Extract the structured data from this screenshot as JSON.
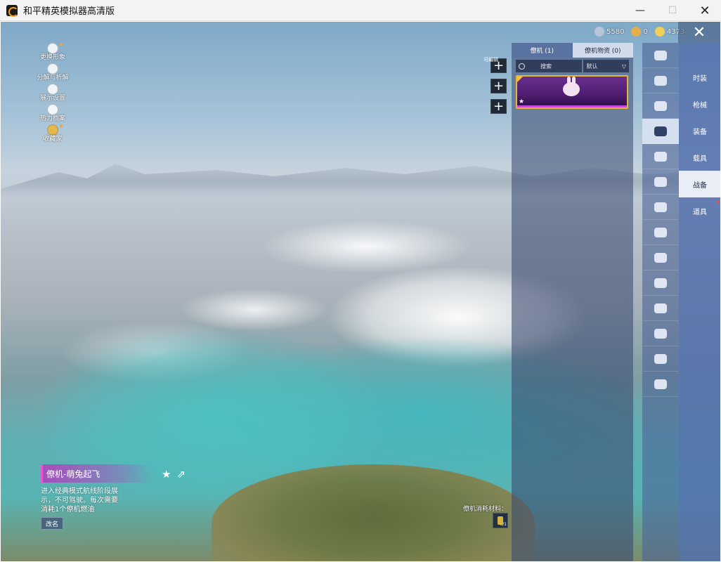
{
  "window": {
    "title": "和平精英模拟器高清版",
    "minimize": "—",
    "maximize": "☐",
    "close": "✕"
  },
  "quick_menu": [
    {
      "label": "更换形象",
      "icon": "avatar-icon",
      "dot": true
    },
    {
      "label": "分解与析解",
      "icon": "disassemble-icon",
      "dot": false
    },
    {
      "label": "展示设置",
      "icon": "eye-icon",
      "dot": false
    },
    {
      "label": "热力档案",
      "icon": "fire-icon",
      "dot": false
    },
    {
      "label": "收藏家",
      "icon": "collector-badge-icon",
      "dot": true
    }
  ],
  "currencies": [
    {
      "value": "5580",
      "icon": "coin-icon",
      "color": "#b8c4d8"
    },
    {
      "value": "0",
      "icon": "token-icon",
      "color": "#e2b04c"
    },
    {
      "value": "4373",
      "icon": "shield-coin-icon",
      "color": "#f0cf57"
    }
  ],
  "close_panel": "✕",
  "plus_buttons": {
    "label": "可编辑",
    "items": [
      "+",
      "+",
      "+"
    ]
  },
  "panel": {
    "tabs": [
      {
        "label": "僚机 (1)",
        "active": true
      },
      {
        "label": "僚机物资 (0)",
        "active": false
      }
    ],
    "search_label": "搜索",
    "sort_label": "默认",
    "sort_arrow": "▽",
    "item": {
      "star": "★",
      "rarity_color": "#e7b33a"
    }
  },
  "icon_column": [
    {
      "icon": "hat-icon",
      "selected": false
    },
    {
      "icon": "boat-icon",
      "selected": false
    },
    {
      "icon": "gun-icon",
      "selected": false
    },
    {
      "icon": "glider-icon",
      "selected": true
    },
    {
      "icon": "smile-icon",
      "selected": false
    },
    {
      "icon": "plane-icon",
      "selected": false
    },
    {
      "icon": "robot-icon",
      "selected": false
    },
    {
      "icon": "speaker-icon",
      "selected": false
    },
    {
      "icon": "camera-icon",
      "selected": false
    },
    {
      "icon": "gallery-icon",
      "selected": false
    },
    {
      "icon": "spray-icon",
      "selected": false
    },
    {
      "icon": "tap-icon",
      "selected": false
    },
    {
      "icon": "wand-icon",
      "selected": false
    },
    {
      "icon": "ufo-icon",
      "selected": false
    }
  ],
  "categories": [
    {
      "label": "时装",
      "selected": false,
      "dot": false
    },
    {
      "label": "枪械",
      "selected": false,
      "dot": false
    },
    {
      "label": "装备",
      "selected": false,
      "dot": false
    },
    {
      "label": "载具",
      "selected": false,
      "dot": false
    },
    {
      "label": "战备",
      "selected": true,
      "dot": false
    },
    {
      "label": "道具",
      "selected": false,
      "dot": true
    }
  ],
  "item_info": {
    "name": "僚机-萌兔起飞",
    "favorite": "★",
    "share": "⇗",
    "description": "进入经典模式航线阶段展示，不可驾驶。每次需要消耗1个僚机燃油",
    "rename": "改名"
  },
  "material": {
    "label": "僚机消耗材料：",
    "count": "0/1"
  }
}
